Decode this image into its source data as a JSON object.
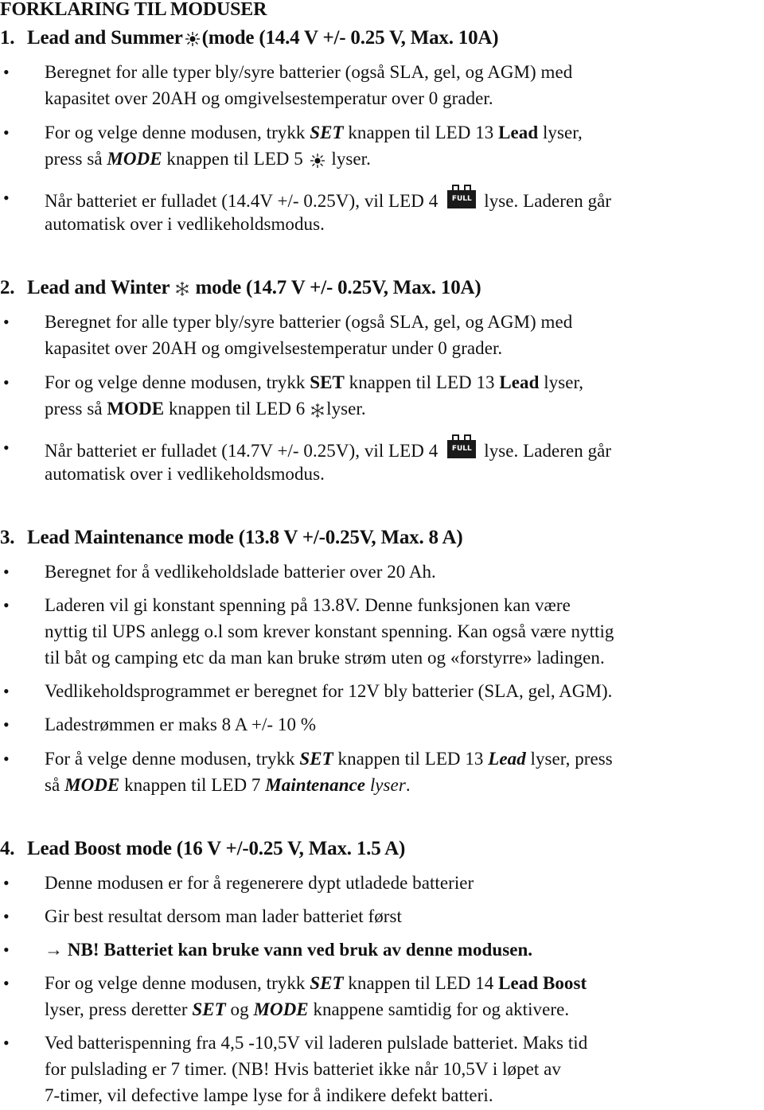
{
  "document": {
    "title": "FORKLARING TIL MODUSER"
  },
  "icons": {
    "sun": "sun-icon",
    "snowflake": "snowflake-icon",
    "full_battery": "full-battery-icon",
    "full_battery_label": "FULL",
    "arrow": "→"
  },
  "sections": [
    {
      "number": "1.",
      "title_pre": "Lead and Summer",
      "title_post": "(mode (14.4 V +/- 0.25 V, Max. 10A)",
      "bullets": [
        {
          "lines": [
            "Beregnet for alle typer bly/syre batterier (også SLA, gel, og AGM) med",
            "kapasitet over 20AH og omgivelsestemperatur over 0 grader."
          ]
        },
        {
          "l1_a": "For og velge denne modusen, trykk ",
          "l1_b": "SET",
          "l1_c": " knappen til LED 13 ",
          "l1_d": "Lead",
          "l1_e": " lyser,",
          "l2_a": "press så ",
          "l2_b": "MODE",
          "l2_c": " knappen til LED 5 ",
          "l2_d": " lyser."
        },
        {
          "l1_a": "Når batteriet er fulladet (14.4V +/- 0.25V), vil  LED 4",
          "l1_b": "lyse. Laderen går",
          "l2": "automatisk over i vedlikeholdsmodus."
        }
      ]
    },
    {
      "number": "2.",
      "title_pre": "Lead and Winter",
      "title_post": "mode (14.7 V +/- 0.25V, Max. 10A)",
      "bullets": [
        {
          "lines": [
            "Beregnet for alle typer bly/syre batterier (også SLA, gel, og AGM) med",
            "kapasitet over 20AH og omgivelsestemperatur under 0 grader."
          ]
        },
        {
          "l1_a": "For og velge denne modusen, trykk ",
          "l1_b": "SET",
          "l1_c": " knappen til LED 13 ",
          "l1_d": "Lead",
          "l1_e": " lyser,",
          "l2_a": "press så ",
          "l2_b": "MODE",
          "l2_c": " knappen til LED 6 ",
          "l2_d": "lyser."
        },
        {
          "l1_a": "Når batteriet er fulladet (14.7V +/- 0.25V),  vil LED 4",
          "l1_b": "lyse. Laderen går",
          "l2": "automatisk over i vedlikeholdsmodus."
        }
      ]
    },
    {
      "number": "3.",
      "title": "Lead Maintenance mode (13.8 V +/-0.25V, Max. 8 A)",
      "bullets": [
        {
          "lines": [
            "Beregnet for å vedlikeholdslade batterier over 20 Ah."
          ]
        },
        {
          "lines": [
            "Laderen vil gi konstant spenning på 13.8V. Denne funksjonen kan være",
            "nyttig til UPS anlegg o.l som krever konstant spenning. Kan også være nyttig",
            "til båt og camping etc da man kan bruke strøm uten og «forstyrre» ladingen."
          ]
        },
        {
          "lines": [
            "Vedlikeholdsprogrammet er beregnet for 12V bly batterier (SLA, gel, AGM)."
          ]
        },
        {
          "lines": [
            "Ladestrømmen er maks 8 A +/- 10 %"
          ]
        },
        {
          "l1_a": "For å velge denne modusen, trykk ",
          "l1_b": "SET",
          "l1_c": " knappen til LED 13 ",
          "l1_d": "Lead",
          "l1_e": " lyser, press",
          "l2_a": "så ",
          "l2_b": "MODE",
          "l2_c": " knappen til LED 7 ",
          "l2_d": "Maintenance",
          "l2_e": " lyser",
          "l2_f": "."
        }
      ]
    },
    {
      "number": "4.",
      "title": "Lead Boost mode (16 V +/-0.25 V,  Max. 1.5 A)",
      "bullets": [
        {
          "lines": [
            "Denne modusen er for å regenerere dypt utladede batterier"
          ]
        },
        {
          "lines": [
            "Gir best resultat dersom man lader batteriet først"
          ]
        },
        {
          "warning": "NB! Batteriet kan bruke vann ved bruk av denne modusen."
        },
        {
          "l1_a": "For og velge denne modusen, trykk ",
          "l1_b": "SET",
          "l1_c": " knappen til LED 14 ",
          "l1_d": "Lead Boost",
          "l2_a": "lyser, press deretter ",
          "l2_b": "SET",
          "l2_c": " og ",
          "l2_d": "MODE",
          "l2_e": " knappene samtidig for og aktivere."
        },
        {
          "lines": [
            "Ved batterispenning fra 4,5 -10,5V vil laderen pulslade batteriet.  Maks tid",
            "for pulslading er 7 timer.  (NB! Hvis batteriet ikke når 10,5V i løpet av",
            "7-timer, vil defective lampe lyse for å indikere defekt batteri."
          ]
        }
      ]
    }
  ]
}
